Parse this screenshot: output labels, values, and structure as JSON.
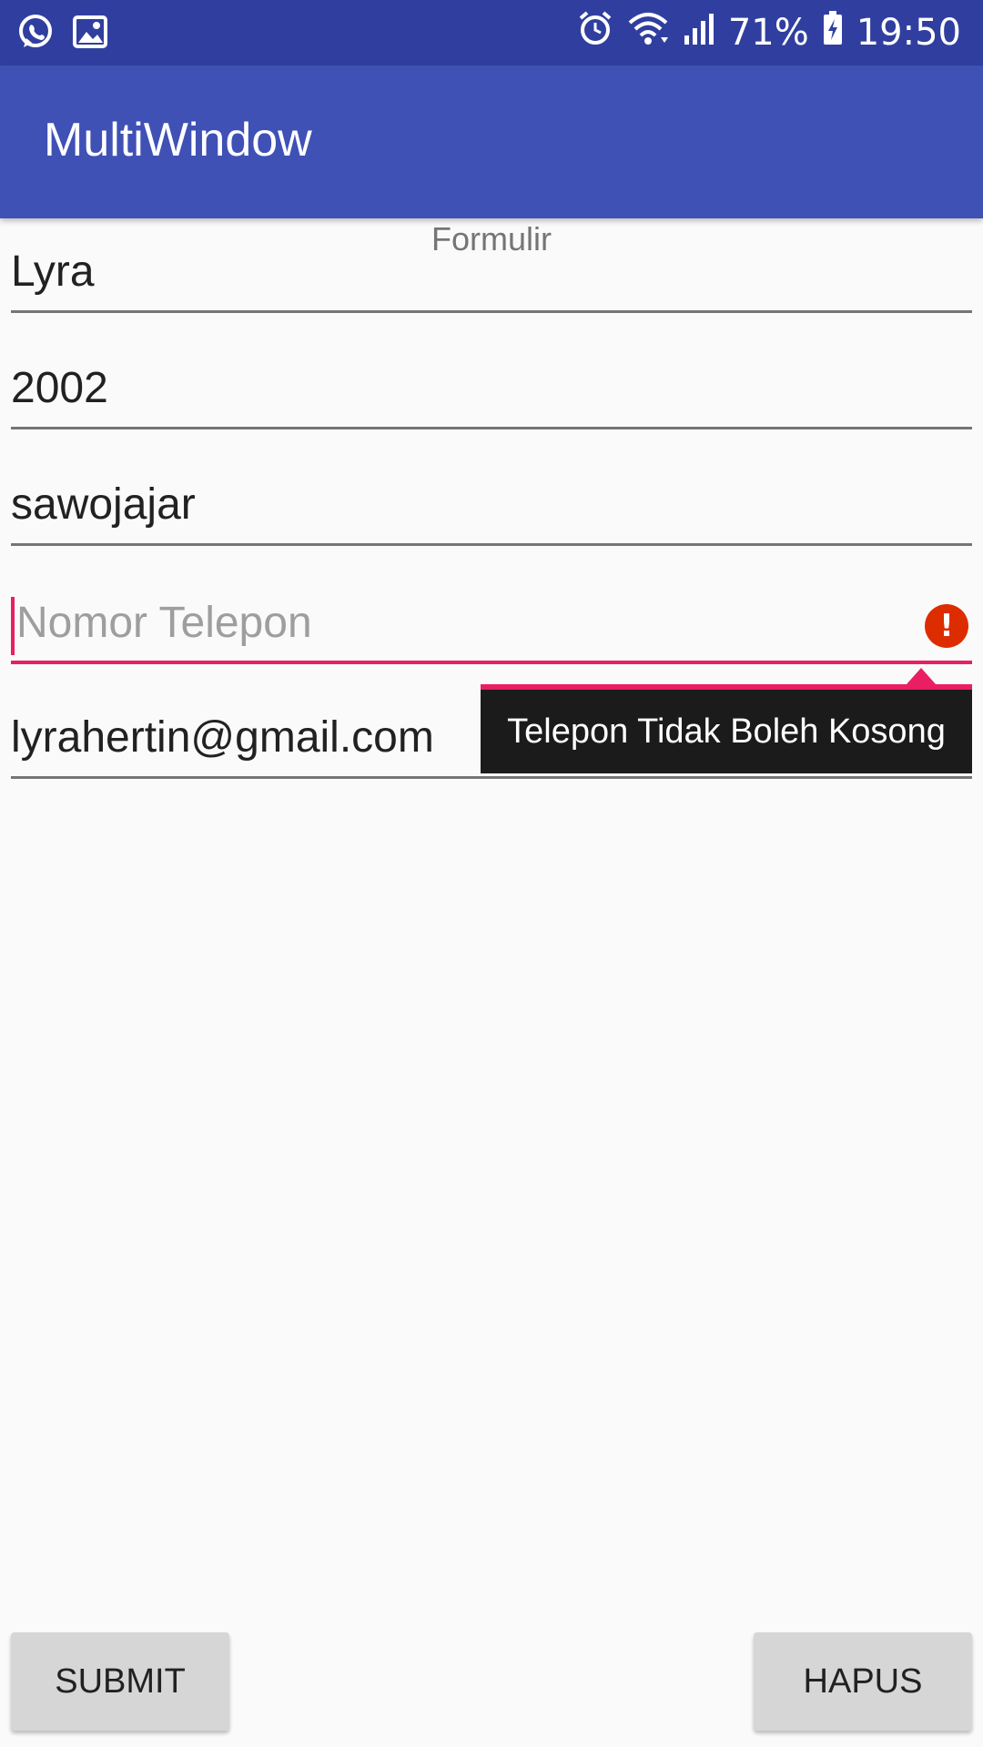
{
  "status_bar": {
    "left_icons": [
      "whatsapp-icon",
      "gallery-icon"
    ],
    "right_icons": [
      "alarm-icon",
      "wifi-icon",
      "signal-icon",
      "battery-charging-icon"
    ],
    "battery": "71%",
    "time": "19:50"
  },
  "app_bar": {
    "title": "MultiWindow",
    "color": "#3f51b5"
  },
  "form": {
    "caption": "Formulir",
    "fields": [
      {
        "value": "Lyra"
      },
      {
        "value": "2002"
      },
      {
        "value": "sawojajar"
      },
      {
        "value": "",
        "placeholder": "Nomor Telepon",
        "error_icon": "error-icon"
      },
      {
        "value": "lyrahertin@gmail.com"
      }
    ],
    "error_tooltip": "Telepon Tidak Boleh Kosong",
    "error_color": "#e91e63"
  },
  "buttons": {
    "submit": "SUBMIT",
    "clear": "HAPUS"
  }
}
